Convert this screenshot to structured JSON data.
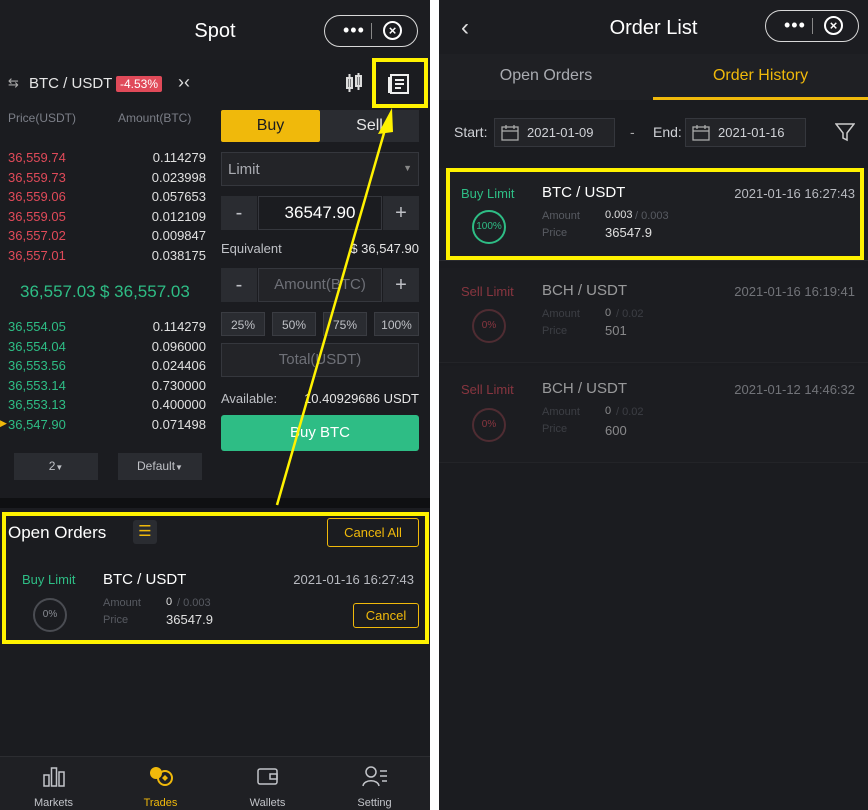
{
  "left": {
    "title": "Spot",
    "pair": "BTC / USDT",
    "change": "-4.53%",
    "book_headers": {
      "price": "Price(USDT)",
      "amount": "Amount(BTC)"
    },
    "asks": [
      {
        "price": "36,559.74",
        "amount": "0.114279"
      },
      {
        "price": "36,559.73",
        "amount": "0.023998"
      },
      {
        "price": "36,559.06",
        "amount": "0.057653"
      },
      {
        "price": "36,559.05",
        "amount": "0.012109"
      },
      {
        "price": "36,557.02",
        "amount": "0.009847"
      },
      {
        "price": "36,557.01",
        "amount": "0.038175"
      }
    ],
    "last_price": "36,557.03",
    "last_price_usd": "$ 36,557.03",
    "bids": [
      {
        "price": "36,554.05",
        "amount": "0.114279"
      },
      {
        "price": "36,554.04",
        "amount": "0.096000"
      },
      {
        "price": "36,553.56",
        "amount": "0.024406"
      },
      {
        "price": "36,553.14",
        "amount": "0.730000"
      },
      {
        "price": "36,553.13",
        "amount": "0.400000"
      },
      {
        "price": "36,547.90",
        "amount": "0.071498"
      }
    ],
    "depth_select": "2",
    "view_select": "Default",
    "buy_tab": "Buy",
    "sell_tab": "Sell",
    "order_type": "Limit",
    "price_value": "36547.90",
    "minus": "-",
    "plus": "+",
    "equivalent_label": "Equivalent",
    "equivalent_value": "$ 36,547.90",
    "amount_placeholder": "Amount(BTC)",
    "percents": [
      "25%",
      "50%",
      "75%",
      "100%"
    ],
    "total_placeholder": "Total(USDT)",
    "available_label": "Available:",
    "available_value": "10.40929686 USDT",
    "buy_button": "Buy BTC",
    "open_orders_title": "Open Orders",
    "cancel_all": "Cancel All",
    "open_order": {
      "side": "Buy Limit",
      "pair": "BTC / USDT",
      "time": "2021-01-16 16:27:43",
      "fill": "0%",
      "amount_label": "Amount",
      "amount_filled": "0",
      "amount_total": "/ 0.003",
      "price_label": "Price",
      "price": "36547.9",
      "cancel": "Cancel"
    },
    "nav": [
      {
        "label": "Markets",
        "icon": "bar-chart-icon"
      },
      {
        "label": "Trades",
        "icon": "trades-icon"
      },
      {
        "label": "Wallets",
        "icon": "wallet-icon"
      },
      {
        "label": "Setting",
        "icon": "setting-icon"
      }
    ]
  },
  "right": {
    "title": "Order List",
    "tabs": [
      "Open Orders",
      "Order History"
    ],
    "start_label": "Start:",
    "start_date": "2021-01-09",
    "dash": "-",
    "end_label": "End:",
    "end_date": "2021-01-16",
    "orders": [
      {
        "side": "Buy Limit",
        "pair": "BTC / USDT",
        "time": "2021-01-16 16:27:43",
        "fill": "100%",
        "amount_label": "Amount",
        "amount_filled": "0.003",
        "amount_total": "/ 0.003",
        "price_label": "Price",
        "price": "36547.9"
      },
      {
        "side": "Sell Limit",
        "pair": "BCH / USDT",
        "time": "2021-01-16 16:19:41",
        "fill": "0%",
        "amount_label": "Amount",
        "amount_filled": "0",
        "amount_total": "/ 0.02",
        "price_label": "Price",
        "price": "501"
      },
      {
        "side": "Sell Limit",
        "pair": "BCH / USDT",
        "time": "2021-01-12 14:46:32",
        "fill": "0%",
        "amount_label": "Amount",
        "amount_filled": "0",
        "amount_total": "/ 0.02",
        "price_label": "Price",
        "price": "600"
      }
    ]
  },
  "colors": {
    "accent": "#f0b90b",
    "buy": "#2ebd85",
    "sell": "#e04a59",
    "highlight": "#fff200"
  }
}
